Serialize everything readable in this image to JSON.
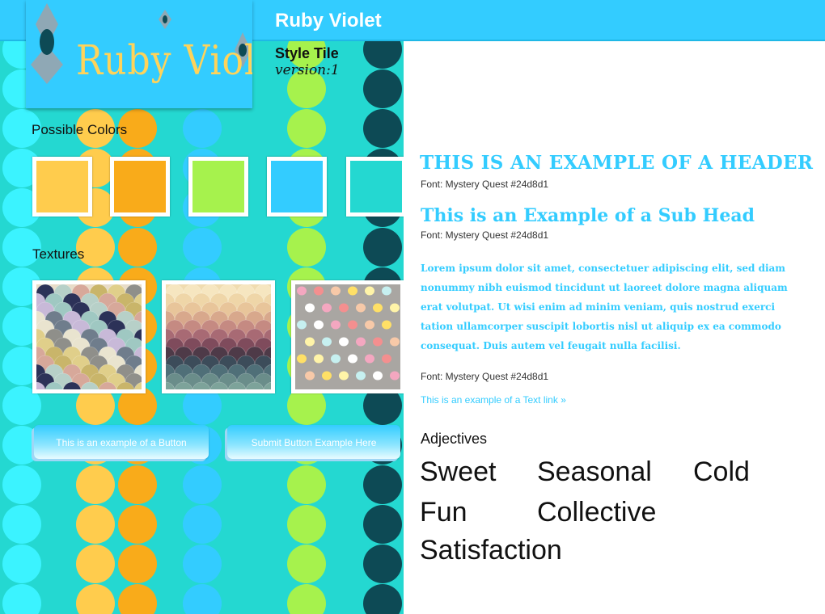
{
  "header": {
    "site_title": "Ruby Violet",
    "tile_title": "Style Tile",
    "version": "version:1"
  },
  "logo": {
    "text": "Ruby Violet"
  },
  "colors": {
    "label": "Possible Colors",
    "swatches": [
      "#ffcc4d",
      "#f9ab1a",
      "#a6f24d",
      "#33ccff",
      "#24d8d1"
    ]
  },
  "textures": {
    "label": "Textures",
    "items": [
      "scallop-pastel-gold-icon",
      "scallop-ombre-icon",
      "pastel-dots-icon"
    ]
  },
  "buttons": {
    "example": "This is an example of a Button",
    "submit": "Submit Button Example Here"
  },
  "typography": {
    "header": "THIS IS AN EXAMPLE OF A HEADER",
    "header_font": "Font: Mystery Quest #24d8d1",
    "subhead": "This is an Example of a Sub Head",
    "subhead_font": "Font: Mystery Quest #24d8d1",
    "body": "Lorem ipsum dolor sit amet, consectetuer adipiscing elit, sed diam nonummy nibh euismod tincidunt ut laoreet dolore magna aliquam erat volutpat. Ut wisi enim ad minim veniam, quis nostrud exerci tation ullamcorper suscipit lobortis nisl ut aliquip ex ea commodo consequat. Duis autem vel feugait nulla facilisi.",
    "body_font": "Font: Mystery Quest #24d8d1",
    "link": "This is an example of a Text link »"
  },
  "adjectives": {
    "label": "Adjectives",
    "words": [
      "Sweet",
      "Seasonal",
      "Cold",
      "Fun",
      "Collective",
      "Satisfaction"
    ]
  },
  "palette": {
    "dots": [
      "#3bf3ff",
      "#ffcc4d",
      "#f9ab1a",
      "#33ccff",
      "#a6f24d",
      "#0d4a55"
    ]
  }
}
